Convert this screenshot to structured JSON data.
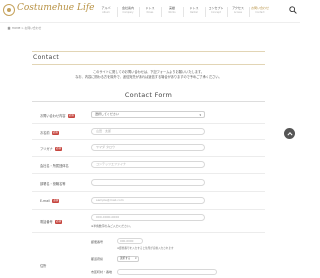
{
  "header": {
    "logo_text": "Costumehue Life",
    "nav": [
      {
        "jp": "アルバ",
        "en": "Album"
      },
      {
        "jp": "会社案内",
        "en": "Company"
      },
      {
        "jp": "ドレス",
        "en": "Dress"
      },
      {
        "jp": "実績",
        "en": "Works"
      },
      {
        "jp": "ドレス",
        "en": "Rental"
      },
      {
        "jp": "コンセプト",
        "en": "Concept"
      },
      {
        "jp": "アクセス",
        "en": "Access"
      },
      {
        "jp": "お問い合わせ",
        "en": "Contact"
      }
    ]
  },
  "breadcrumb": {
    "home": "HOME",
    "separator": ">",
    "current": "お問い合わせ"
  },
  "main": {
    "page_title": "Contact",
    "intro_line1": "このサイトに関してのお問い合わせは、下記フォームよりお願いいたします。",
    "intro_line2": "なお、内容に関わる方を除外で、返信宛先があれば返信する場合がありますので予めご了承ください。",
    "form_title": "Contact Form"
  },
  "form": {
    "required_badge": "必須",
    "inquiry_label": "お問い合わせ内容",
    "inquiry_select": "選択してください",
    "name_label": "お名前",
    "name_placeholder": "山田　太郎",
    "kana_label": "フリガナ",
    "kana_placeholder": "ヤマダ タロウ",
    "company_label": "会社名・所属団体名",
    "company_placeholder": "コンテッツエファイナ",
    "dept_label": "部署名・役職名等",
    "dept_placeholder": "",
    "email_label": "E-mail",
    "email_placeholder": "sample@mail.com",
    "phone_label": "電話番号",
    "phone_placeholder": "000-0000-0000",
    "phone_note": "※半角数字のみご入力ください。",
    "zip_label": "郵便番号",
    "zip_placeholder": "000-0000",
    "zip_note": "※郵便番号を入力すると住所が自動入力されます",
    "pref_label": "都道府県",
    "pref_select": "選択する",
    "city_label": "市区町村・番地",
    "address_label": "住所"
  },
  "colors": {
    "gold": "#b89244",
    "required": "#c6463f",
    "to_top": "#555555"
  },
  "icons": [
    "search-icon",
    "home-icon",
    "chevron-down-icon",
    "arrow-up-icon"
  ]
}
